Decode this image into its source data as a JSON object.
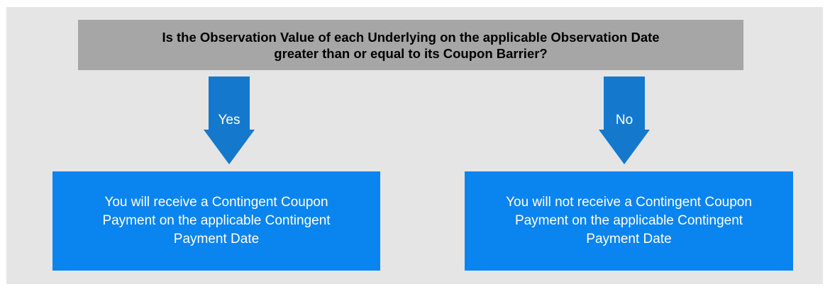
{
  "question": {
    "text": "Is the Observation Value of each Underlying on the applicable Observation Date\ngreater than or equal to its Coupon Barrier?"
  },
  "branches": [
    {
      "label": "Yes",
      "outcome": "You will receive a Contingent Coupon\nPayment on the applicable Contingent\nPayment Date"
    },
    {
      "label": "No",
      "outcome": "You will not receive a Contingent Coupon\nPayment on the applicable Contingent\nPayment Date"
    }
  ],
  "colors": {
    "background": "#e5e5e5",
    "question_box": "#a6a6a6",
    "arrow": "#1479cc",
    "outcome_box": "#0a84ee",
    "outcome_text": "#ffffff"
  },
  "icons": [
    "down-arrow-icon"
  ]
}
